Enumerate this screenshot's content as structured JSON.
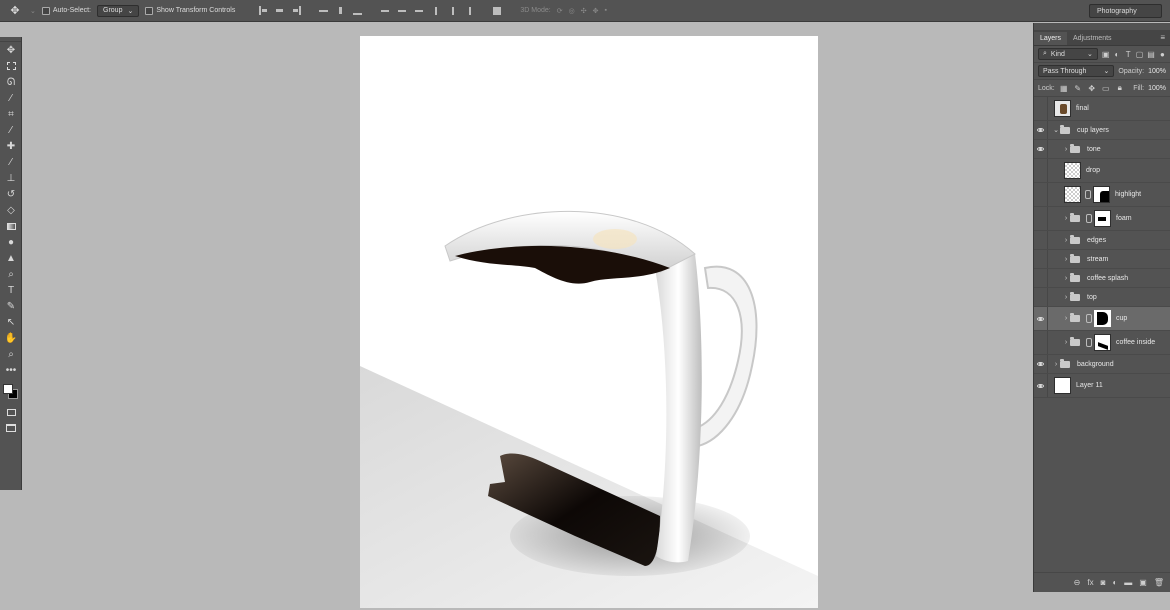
{
  "options_bar": {
    "auto_select_label": "Auto-Select:",
    "auto_select_value": "Group",
    "transform_controls_label": "Show Transform Controls",
    "mode_3d_label": "3D Mode:",
    "workspace": "Photography"
  },
  "tools": [
    "move-tool",
    "marquee-tool",
    "lasso-tool",
    "magic-wand-tool",
    "crop-tool",
    "eyedropper-tool",
    "healing-brush-tool",
    "brush-tool",
    "clone-stamp-tool",
    "history-brush-tool",
    "eraser-tool",
    "gradient-tool",
    "blur-tool",
    "dodge-tool",
    "pen-tool",
    "type-tool",
    "path-selection-tool",
    "shape-tool",
    "hand-tool",
    "zoom-tool",
    "more-tools"
  ],
  "layers_panel": {
    "tabs": [
      "Layers",
      "Adjustments"
    ],
    "filter_kind": "Kind",
    "blend_mode": "Pass Through",
    "opacity_label": "Opacity:",
    "opacity_value": "100%",
    "lock_label": "Lock:",
    "fill_label": "Fill:",
    "fill_value": "100%",
    "layers": [
      {
        "name": "final",
        "type": "image",
        "visible": false
      },
      {
        "name": "cup layers",
        "type": "group",
        "visible": true,
        "expanded": true
      },
      {
        "name": "tone",
        "type": "group",
        "visible": true
      },
      {
        "name": "drop",
        "type": "pixel",
        "visible": false
      },
      {
        "name": "highlight",
        "type": "masked",
        "visible": false
      },
      {
        "name": "foam",
        "type": "group-masked",
        "visible": false
      },
      {
        "name": "edges",
        "type": "group",
        "visible": false
      },
      {
        "name": "stream",
        "type": "group",
        "visible": false
      },
      {
        "name": "coffee splash",
        "type": "group",
        "visible": false
      },
      {
        "name": "top",
        "type": "group",
        "visible": false
      },
      {
        "name": "cup",
        "type": "group-masked",
        "visible": true,
        "selected": true
      },
      {
        "name": "coffee inside",
        "type": "group-masked",
        "visible": false
      },
      {
        "name": "background",
        "type": "group",
        "visible": true
      },
      {
        "name": "Layer 11",
        "type": "pixel-white",
        "visible": true
      }
    ]
  },
  "colors": {
    "panel": "#535353",
    "app_bg": "#b9b9b9",
    "canvas": "#ffffff",
    "coffee": "#1a0e08"
  }
}
